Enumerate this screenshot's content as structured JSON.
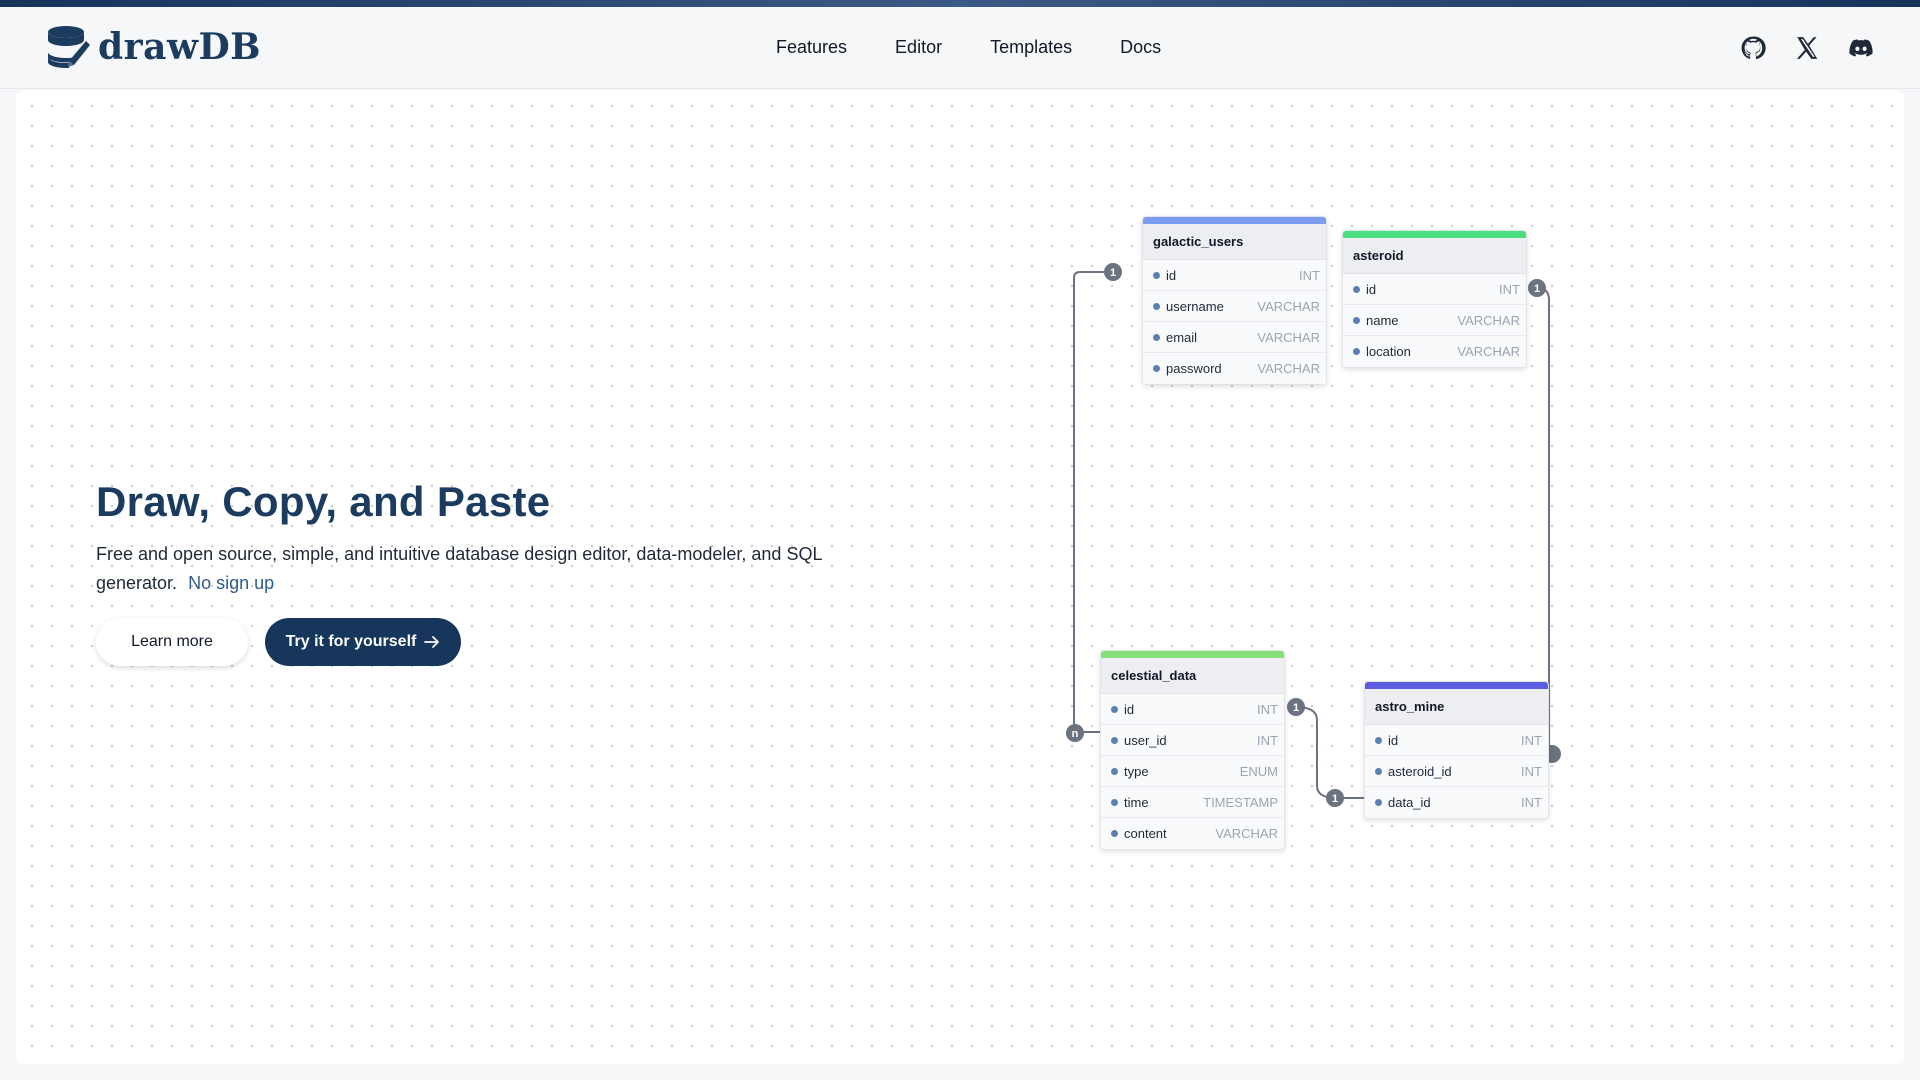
{
  "header": {
    "brand": "drawDB",
    "nav": [
      "Features",
      "Editor",
      "Templates",
      "Docs"
    ],
    "socials": [
      "github-icon",
      "x-icon",
      "discord-icon"
    ]
  },
  "hero": {
    "title": "Draw, Copy, and Paste",
    "description": "Free and open source, simple, and intuitive database design editor, data-modeler, and SQL generator.",
    "highlight": "No sign up",
    "learn_more": "Learn more",
    "try_it": "Try it for yourself",
    "try_it_icon": "arrow-right-icon"
  },
  "diagram": {
    "tables": [
      {
        "name": "galactic_users",
        "color": "#7b9cf0",
        "fields": [
          {
            "name": "id",
            "type": "INT"
          },
          {
            "name": "username",
            "type": "VARCHAR"
          },
          {
            "name": "email",
            "type": "VARCHAR"
          },
          {
            "name": "password",
            "type": "VARCHAR"
          }
        ]
      },
      {
        "name": "asteroid",
        "color": "#4ade80",
        "fields": [
          {
            "name": "id",
            "type": "INT"
          },
          {
            "name": "name",
            "type": "VARCHAR"
          },
          {
            "name": "location",
            "type": "VARCHAR"
          }
        ]
      },
      {
        "name": "celestial_data",
        "color": "#86e07a",
        "fields": [
          {
            "name": "id",
            "type": "INT"
          },
          {
            "name": "user_id",
            "type": "INT"
          },
          {
            "name": "type",
            "type": "ENUM"
          },
          {
            "name": "time",
            "type": "TIMESTAMP"
          },
          {
            "name": "content",
            "type": "VARCHAR"
          }
        ]
      },
      {
        "name": "astro_mine",
        "color": "#5b5ce0",
        "fields": [
          {
            "name": "id",
            "type": "INT"
          },
          {
            "name": "asteroid_id",
            "type": "INT"
          },
          {
            "name": "data_id",
            "type": "INT"
          }
        ]
      }
    ],
    "cardinality": {
      "one": "1",
      "many": "n"
    }
  }
}
